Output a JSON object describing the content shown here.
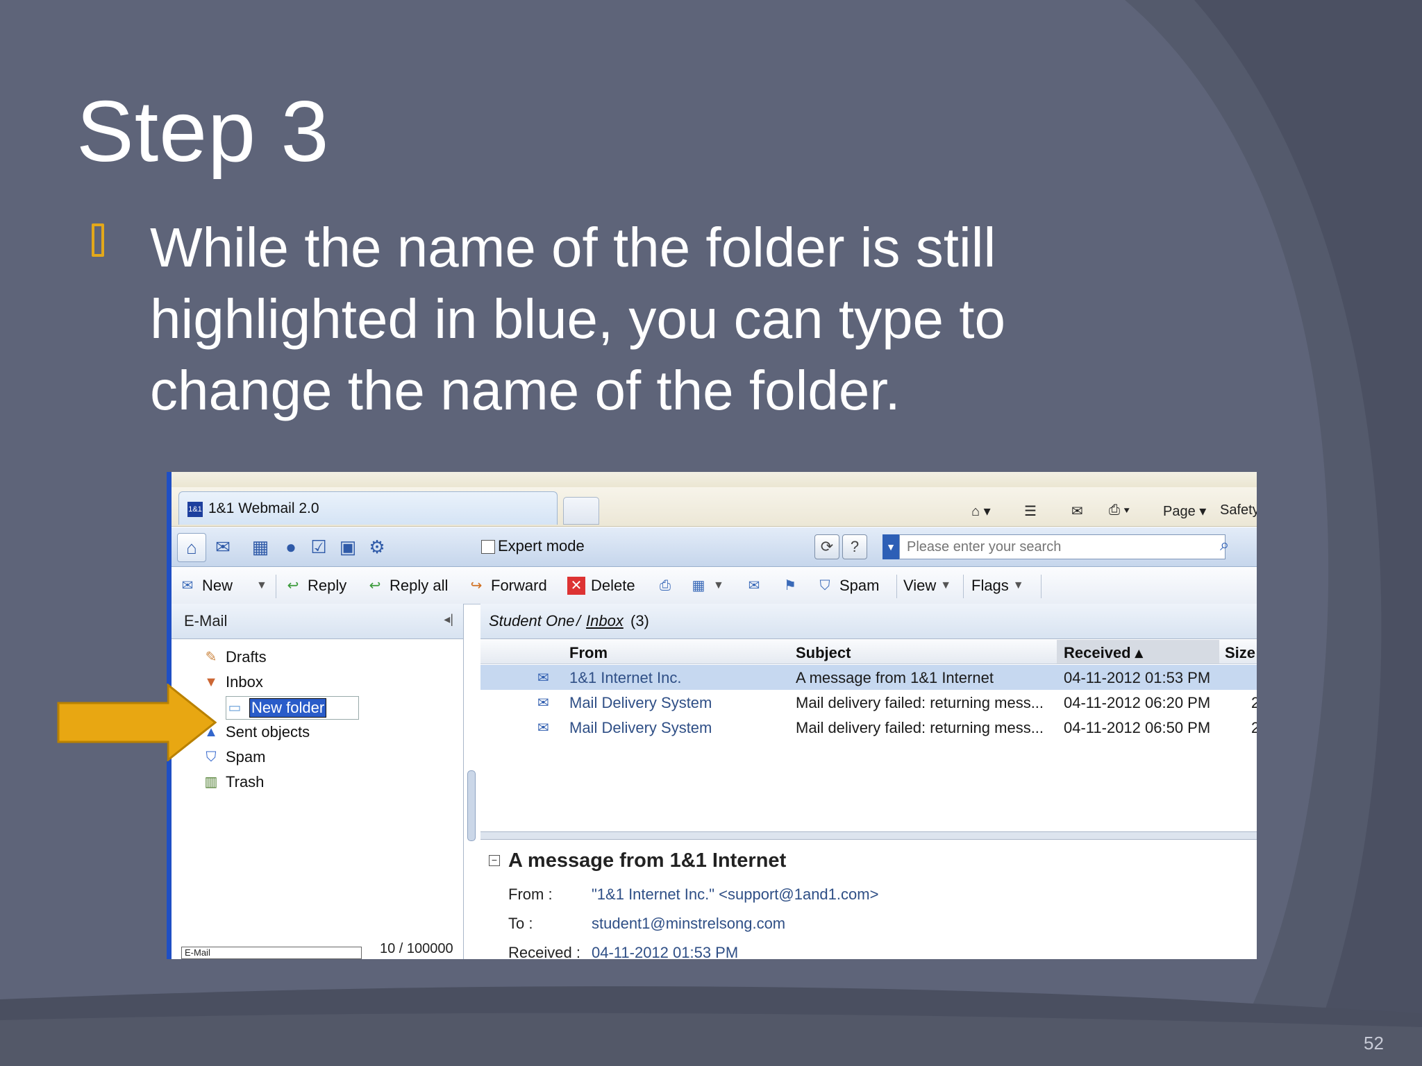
{
  "slide": {
    "title": "Step 3",
    "bullet": "While the name of the folder is still highlighted in blue, you can type to change the name of the folder.",
    "number": "52"
  },
  "browser": {
    "tab_title": "1&1 Webmail 2.0",
    "tab_logo": "1&1",
    "tools": {
      "page": "Page ▾",
      "safety": "Safety"
    }
  },
  "app": {
    "expert_mode": "Expert mode",
    "search_placeholder": "Please enter your search"
  },
  "toolbar": {
    "new": "New",
    "reply": "Reply",
    "reply_all": "Reply all",
    "forward": "Forward",
    "delete": "Delete",
    "spam": "Spam",
    "view": "View",
    "flags": "Flags"
  },
  "sidebar": {
    "title": "E-Mail",
    "folders": [
      "Drafts",
      "Inbox",
      "New folder",
      "Sent objects",
      "Spam",
      "Trash"
    ],
    "footer_tab": "E-Mail",
    "quota": "10 / 100000"
  },
  "maillist": {
    "breadcrumb_user": "Student One",
    "breadcrumb_sep": "/",
    "breadcrumb_folder": "Inbox",
    "breadcrumb_count": "(3)",
    "columns": {
      "from": "From",
      "subject": "Subject",
      "received": "Received ▴",
      "size": "Size"
    },
    "rows": [
      {
        "from": "1&1 Internet Inc.",
        "subject": "A message from 1&1 Internet",
        "received": "04-11-2012 01:53 PM",
        "size": ""
      },
      {
        "from": "Mail Delivery System",
        "subject": "Mail delivery failed: returning mess...",
        "received": "04-11-2012 06:20 PM",
        "size": "2"
      },
      {
        "from": "Mail Delivery System",
        "subject": "Mail delivery failed: returning mess...",
        "received": "04-11-2012 06:50 PM",
        "size": "2"
      }
    ]
  },
  "preview": {
    "subject": "A message from 1&1 Internet",
    "from_label": "From :",
    "from_value": "\"1&1 Internet Inc.\" <support@1and1.com>",
    "to_label": "To :",
    "to_value": "student1@minstrelsong.com",
    "received_label": "Received :",
    "received_value": "04-11-2012 01:53 PM"
  },
  "colors": {
    "background": "#5e6479",
    "accent_arrow": "#e8a712",
    "selection": "#2a5cc9"
  }
}
